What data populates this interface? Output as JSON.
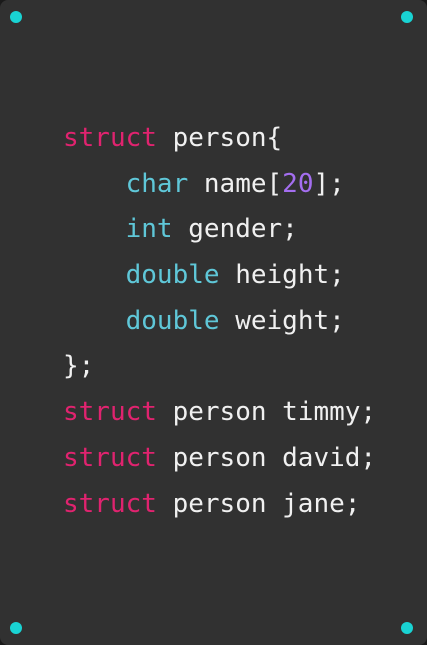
{
  "colors": {
    "background": "#313131",
    "accent_dots": "#19d3d3",
    "keyword": "#e0236f",
    "type": "#5fc7d8",
    "number": "#a46ef0",
    "text": "#f0f0f0"
  },
  "code": {
    "lines": [
      {
        "tokens": [
          {
            "t": "struct",
            "k": "kw"
          },
          {
            "t": " person{",
            "k": "txt"
          }
        ]
      },
      {
        "tokens": [
          {
            "t": "    ",
            "k": "txt"
          },
          {
            "t": "char",
            "k": "ty"
          },
          {
            "t": " name[",
            "k": "txt"
          },
          {
            "t": "20",
            "k": "num"
          },
          {
            "t": "];",
            "k": "txt"
          }
        ]
      },
      {
        "tokens": [
          {
            "t": "    ",
            "k": "txt"
          },
          {
            "t": "int",
            "k": "ty"
          },
          {
            "t": " gender;",
            "k": "txt"
          }
        ]
      },
      {
        "tokens": [
          {
            "t": "    ",
            "k": "txt"
          },
          {
            "t": "double",
            "k": "ty"
          },
          {
            "t": " height;",
            "k": "txt"
          }
        ]
      },
      {
        "tokens": [
          {
            "t": "    ",
            "k": "txt"
          },
          {
            "t": "double",
            "k": "ty"
          },
          {
            "t": " weight;",
            "k": "txt"
          }
        ]
      },
      {
        "tokens": [
          {
            "t": "};",
            "k": "txt"
          }
        ]
      },
      {
        "tokens": [
          {
            "t": "struct",
            "k": "kw"
          },
          {
            "t": " person timmy;",
            "k": "txt"
          }
        ]
      },
      {
        "tokens": [
          {
            "t": "struct",
            "k": "kw"
          },
          {
            "t": " person david;",
            "k": "txt"
          }
        ]
      },
      {
        "tokens": [
          {
            "t": "struct",
            "k": "kw"
          },
          {
            "t": " person jane;",
            "k": "txt"
          }
        ]
      }
    ]
  }
}
